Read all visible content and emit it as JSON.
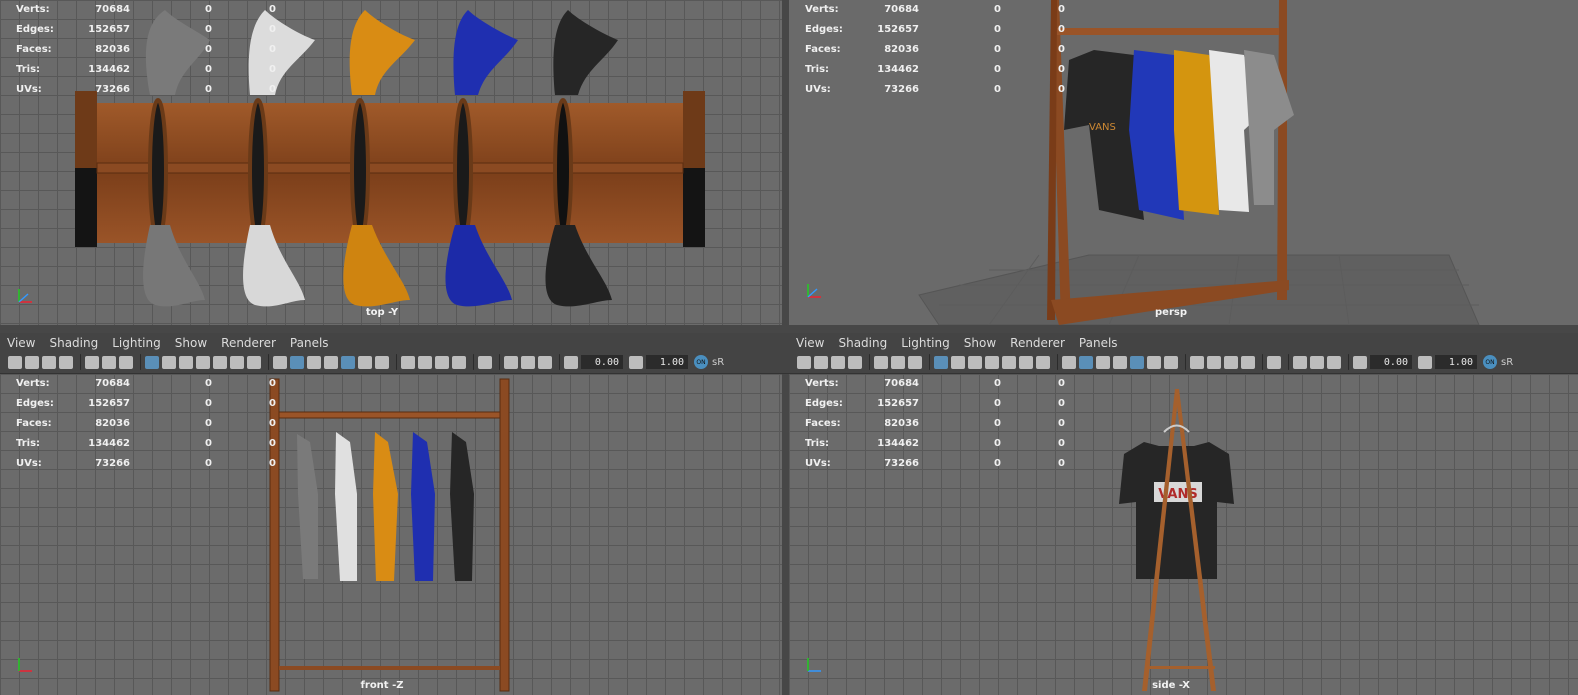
{
  "stats_labels": [
    "Verts:",
    "Edges:",
    "Faces:",
    "Tris:",
    "UVs:"
  ],
  "stats_values": [
    [
      "70684",
      "0",
      "0"
    ],
    [
      "152657",
      "0",
      "0"
    ],
    [
      "82036",
      "0",
      "0"
    ],
    [
      "134462",
      "0",
      "0"
    ],
    [
      "73266",
      "0",
      "0"
    ]
  ],
  "viewports": {
    "top": "top -Y",
    "persp": "persp",
    "front": "front -Z",
    "side": "side -X"
  },
  "menu": [
    "View",
    "Shading",
    "Lighting",
    "Show",
    "Renderer",
    "Panels"
  ],
  "toolbar": {
    "exposure": "0.00",
    "gamma": "1.00",
    "colorspace_icon": "ON",
    "colorspace_text": "sR"
  },
  "colors": {
    "shirt_gray": "#7a7a7a",
    "shirt_white": "#e6e6e6",
    "shirt_orange": "#d98c14",
    "shirt_blue": "#1f2fb0",
    "shirt_black": "#262626",
    "wood": "#8a4a22",
    "accent": "#5a8fb8"
  },
  "shirt_print": "VANS",
  "axis_labels": {
    "x": "x",
    "y": "y",
    "z": "z"
  }
}
